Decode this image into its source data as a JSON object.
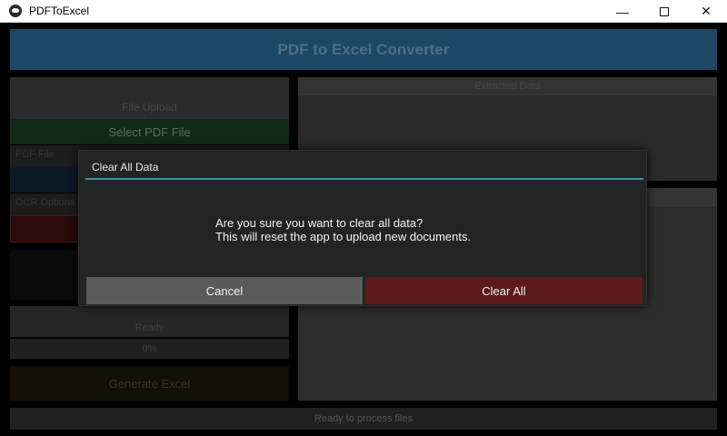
{
  "window": {
    "title": "PDFToExcel",
    "minimize_glyph": "—",
    "close_glyph": "✕"
  },
  "app": {
    "header_title": "PDF to Excel Converter",
    "file_upload_label": "File Upload",
    "select_pdf_label": "Select PDF File",
    "pdf_file_label": "PDF File",
    "ocr_label": "OCR Options",
    "ready_label": "Ready",
    "percent_label": "0%",
    "generate_label": "Generate Excel",
    "preview_label": "Extracted Data",
    "status_text": "Ready to process files"
  },
  "dialog": {
    "title": "Clear All Data",
    "message_line1": "Are you sure you want to clear all data?",
    "message_line2": "This will reset the app to upload new documents.",
    "cancel_label": "Cancel",
    "confirm_label": "Clear All"
  },
  "colors": {
    "accent_divider": "#3b8fb5",
    "danger_button": "#5c1a1a",
    "cancel_button": "#5a5a5a"
  }
}
